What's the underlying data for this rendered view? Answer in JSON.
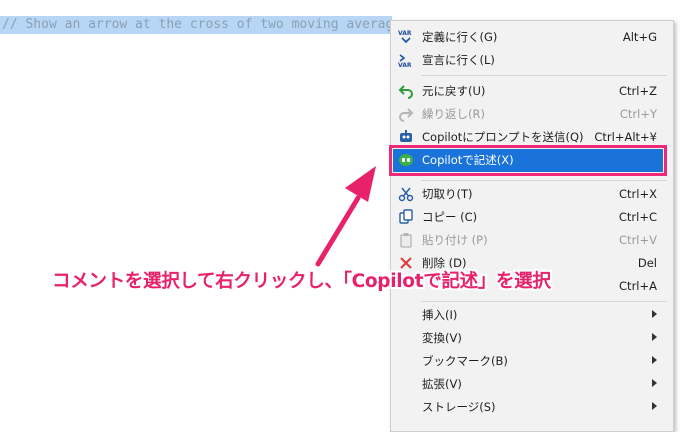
{
  "editor": {
    "selected_code": "// Show an arrow at the cross of two moving averages"
  },
  "context_menu": {
    "items": [
      {
        "label": "定義に行く(G)",
        "shortcut": "Alt+G",
        "icon": "var-goto-icon"
      },
      {
        "label": "宣言に行く(L)",
        "shortcut": "",
        "icon": "var-declaration-icon"
      },
      {
        "label": "元に戻す(U)",
        "shortcut": "Ctrl+Z",
        "icon": "undo-icon"
      },
      {
        "label": "繰り返し(R)",
        "shortcut": "Ctrl+Y",
        "icon": "redo-icon"
      },
      {
        "label": "Copilotにプロンプトを送信(Q)",
        "shortcut": "Ctrl+Alt+¥",
        "icon": "robot-icon"
      },
      {
        "label": "Copilotで記述(X)",
        "shortcut": "",
        "icon": "copilot-icon"
      },
      {
        "label": "切取り(T)",
        "shortcut": "Ctrl+X",
        "icon": "scissors-icon"
      },
      {
        "label": "コピー (C)",
        "shortcut": "Ctrl+C",
        "icon": "copy-icon"
      },
      {
        "label": "貼り付け (P)",
        "shortcut": "Ctrl+V",
        "icon": "paste-icon"
      },
      {
        "label": "削除 (D)",
        "shortcut": "Del",
        "icon": "delete-icon"
      },
      {
        "label": "",
        "shortcut": "Ctrl+A",
        "icon": ""
      },
      {
        "label": "挿入(I)",
        "shortcut": "",
        "icon": ""
      },
      {
        "label": "変換(V)",
        "shortcut": "",
        "icon": ""
      },
      {
        "label": "ブックマーク(B)",
        "shortcut": "",
        "icon": ""
      },
      {
        "label": "拡張(V)",
        "shortcut": "",
        "icon": ""
      },
      {
        "label": "ストレージ(S)",
        "shortcut": "",
        "icon": ""
      }
    ]
  },
  "annotation": {
    "text": "コメントを選択して右クリックし、「Copilotで記述」を選択"
  },
  "colors": {
    "highlight": "#1a73d9",
    "annotation": "#e8226a",
    "selection": "#b7d6f5"
  }
}
